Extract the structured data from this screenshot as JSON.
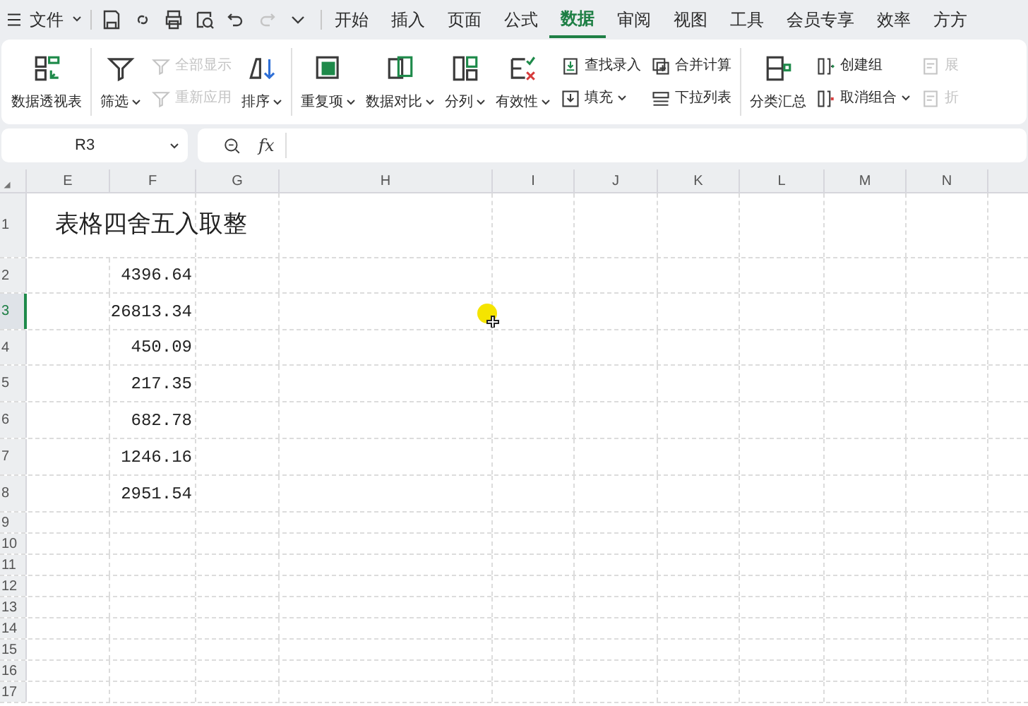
{
  "menu": {
    "file": "文件"
  },
  "tabs": [
    {
      "label": "开始",
      "selected": false
    },
    {
      "label": "插入",
      "selected": false
    },
    {
      "label": "页面",
      "selected": false
    },
    {
      "label": "公式",
      "selected": false
    },
    {
      "label": "数据",
      "selected": true
    },
    {
      "label": "审阅",
      "selected": false
    },
    {
      "label": "视图",
      "selected": false
    },
    {
      "label": "工具",
      "selected": false
    },
    {
      "label": "会员专享",
      "selected": false
    },
    {
      "label": "效率",
      "selected": false
    },
    {
      "label": "方方",
      "selected": false
    }
  ],
  "ribbon": [
    {
      "items": [
        {
          "kind": "large",
          "label": "数据透视表",
          "caret": false,
          "disabled": false
        }
      ]
    },
    {
      "items": [
        {
          "kind": "large",
          "label": "筛选",
          "caret": true,
          "disabled": false
        },
        {
          "kind": "stack",
          "entries": [
            {
              "label": "全部显示",
              "caret": false,
              "disabled": true
            },
            {
              "label": "重新应用",
              "caret": false,
              "disabled": true
            }
          ]
        },
        {
          "kind": "large",
          "label": "排序",
          "caret": true,
          "disabled": false
        }
      ]
    },
    {
      "items": [
        {
          "kind": "large",
          "label": "重复项",
          "caret": true,
          "disabled": false
        },
        {
          "kind": "large",
          "label": "数据对比",
          "caret": true,
          "disabled": false
        },
        {
          "kind": "large",
          "label": "分列",
          "caret": true,
          "disabled": false
        },
        {
          "kind": "large",
          "label": "有效性",
          "caret": true,
          "disabled": false
        },
        {
          "kind": "stack",
          "entries": [
            {
              "label": "查找录入",
              "caret": false,
              "disabled": false
            },
            {
              "label": "填充",
              "caret": true,
              "disabled": false
            }
          ]
        },
        {
          "kind": "stack",
          "entries": [
            {
              "label": "合并计算",
              "caret": false,
              "disabled": false
            },
            {
              "label": "下拉列表",
              "caret": false,
              "disabled": false
            }
          ]
        }
      ]
    },
    {
      "items": [
        {
          "kind": "large",
          "label": "分类汇总",
          "caret": false,
          "disabled": false
        },
        {
          "kind": "stack",
          "entries": [
            {
              "label": "创建组",
              "caret": false,
              "disabled": false
            },
            {
              "label": "取消组合",
              "caret": true,
              "disabled": false
            }
          ]
        },
        {
          "kind": "stack",
          "entries": [
            {
              "label": "展",
              "caret": false,
              "disabled": true
            },
            {
              "label": "折",
              "caret": false,
              "disabled": true
            }
          ]
        }
      ]
    }
  ],
  "formula_bar": {
    "name_box": "R3",
    "function_label": "fx"
  },
  "columns": [
    "E",
    "F",
    "G",
    "H",
    "I",
    "J",
    "K",
    "L",
    "M",
    "N"
  ],
  "rows": [
    {
      "label": "1",
      "selected": false,
      "kind": "title",
      "text": "表格四舍五入取整"
    },
    {
      "label": "2",
      "selected": false,
      "kind": "value",
      "text": "4396.64"
    },
    {
      "label": "3",
      "selected": true,
      "kind": "value",
      "text": "26813.34"
    },
    {
      "label": "4",
      "selected": false,
      "kind": "value",
      "text": "450.09"
    },
    {
      "label": "5",
      "selected": false,
      "kind": "value",
      "text": "217.35"
    },
    {
      "label": "6",
      "selected": false,
      "kind": "value",
      "text": "682.78"
    },
    {
      "label": "7",
      "selected": false,
      "kind": "value",
      "text": "1246.16"
    },
    {
      "label": "8",
      "selected": false,
      "kind": "value",
      "text": "2951.54"
    },
    {
      "label": "9",
      "selected": false,
      "kind": "empty"
    },
    {
      "label": "10",
      "selected": false,
      "kind": "empty"
    },
    {
      "label": "11",
      "selected": false,
      "kind": "empty"
    },
    {
      "label": "12",
      "selected": false,
      "kind": "empty"
    },
    {
      "label": "13",
      "selected": false,
      "kind": "empty"
    },
    {
      "label": "14",
      "selected": false,
      "kind": "empty"
    },
    {
      "label": "15",
      "selected": false,
      "kind": "empty"
    },
    {
      "label": "16",
      "selected": false,
      "kind": "empty"
    },
    {
      "label": "17",
      "selected": false,
      "kind": "empty"
    }
  ]
}
